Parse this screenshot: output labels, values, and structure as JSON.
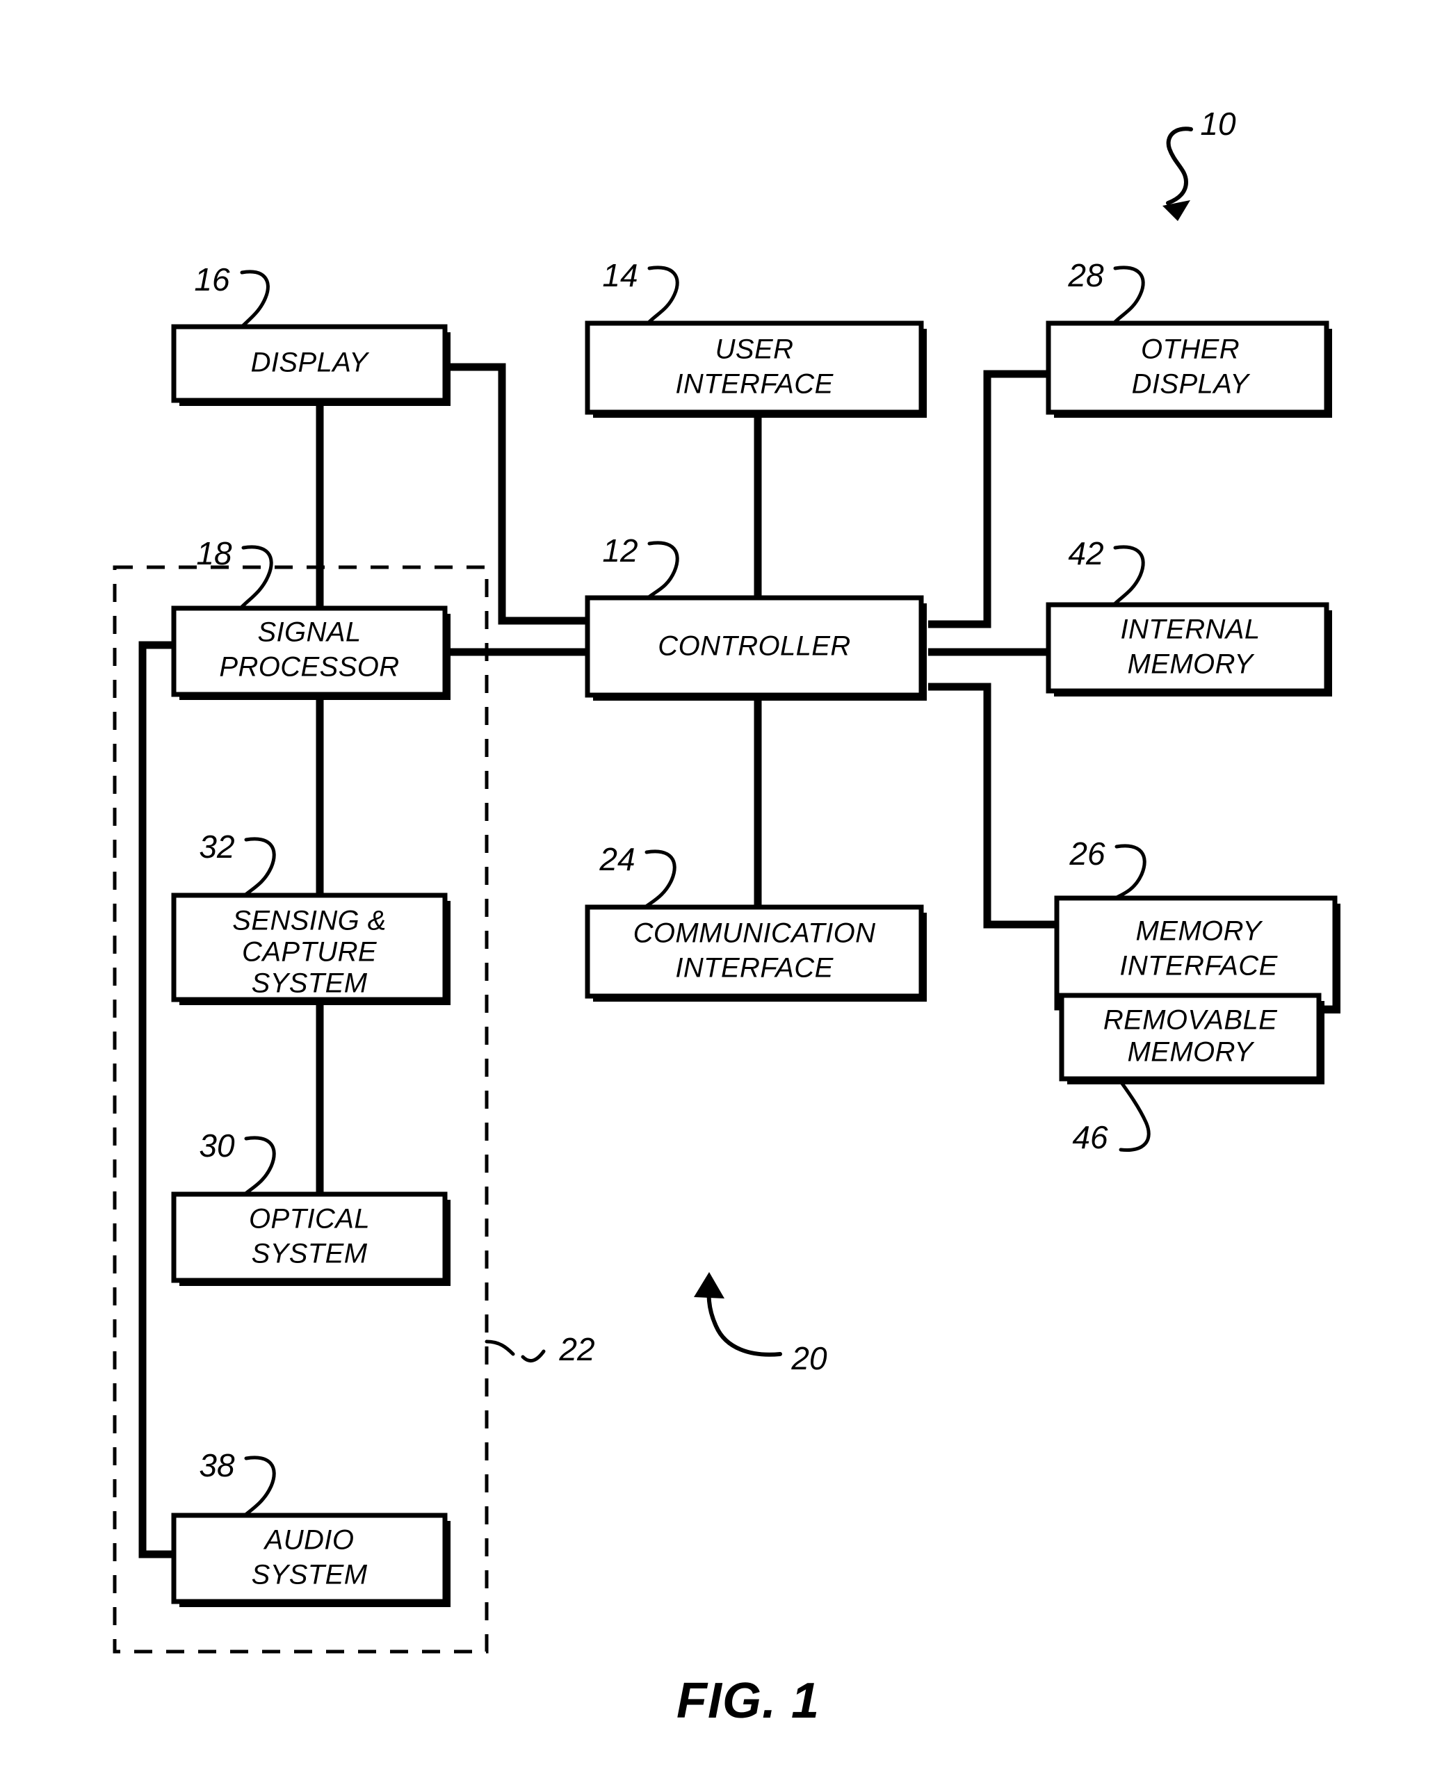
{
  "figure": {
    "caption": "FIG. 1",
    "system_ref": "10",
    "camera_phone_ref": "20",
    "capture_assembly_ref": "22"
  },
  "blocks": {
    "display": {
      "ref": "16",
      "line1": "DISPLAY",
      "line2": ""
    },
    "user_interface": {
      "ref": "14",
      "line1": "USER",
      "line2": "INTERFACE"
    },
    "other_display": {
      "ref": "28",
      "line1": "OTHER",
      "line2": "DISPLAY"
    },
    "signal_processor": {
      "ref": "18",
      "line1": "SIGNAL",
      "line2": "PROCESSOR"
    },
    "controller": {
      "ref": "12",
      "line1": "CONTROLLER",
      "line2": ""
    },
    "internal_memory": {
      "ref": "42",
      "line1": "INTERNAL",
      "line2": "MEMORY"
    },
    "sensing_capture": {
      "ref": "32",
      "line1": "SENSING &",
      "line2": "CAPTURE",
      "line3": "SYSTEM"
    },
    "communication_interface": {
      "ref": "24",
      "line1": "COMMUNICATION",
      "line2": "INTERFACE"
    },
    "memory_interface": {
      "ref": "26",
      "line1": "MEMORY",
      "line2": "INTERFACE"
    },
    "removable_memory": {
      "ref": "46",
      "line1": "REMOVABLE",
      "line2": "MEMORY"
    },
    "optical_system": {
      "ref": "30",
      "line1": "OPTICAL",
      "line2": "SYSTEM"
    },
    "audio_system": {
      "ref": "38",
      "line1": "AUDIO",
      "line2": "SYSTEM"
    }
  },
  "colors": {
    "ink": "#000000",
    "paper": "#ffffff"
  }
}
